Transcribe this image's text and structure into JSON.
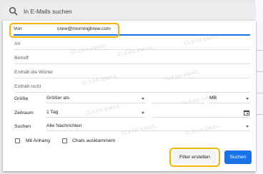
{
  "search": {
    "placeholder": "In E-Mails suchen"
  },
  "dialog": {
    "from": {
      "label": "Von",
      "value": "crew@morningbrew.com"
    },
    "to": {
      "label": "An"
    },
    "subject": {
      "label": "Betreff"
    },
    "has_words": {
      "label": "Enthält die Wörter"
    },
    "no_words": {
      "label": "Enthält nicht"
    },
    "size": {
      "label": "Größe",
      "comparator": "Größer als",
      "unit": "MB"
    },
    "date": {
      "label": "Zeitraum",
      "value": "1 Tag"
    },
    "search_in": {
      "label": "Suchen",
      "value": "Alle Nachrichten"
    },
    "has_attachment": {
      "label": "Mit Anhang",
      "checked": false
    },
    "exclude_chats": {
      "label": "Chats ausklammern",
      "checked": false
    },
    "create_filter_label": "Filter erstellen",
    "search_button_label": "Suchen",
    "watermark": "CLEAN.EMAIL"
  },
  "colors": {
    "accent": "#1a73e8",
    "highlight": "#f4b400"
  }
}
